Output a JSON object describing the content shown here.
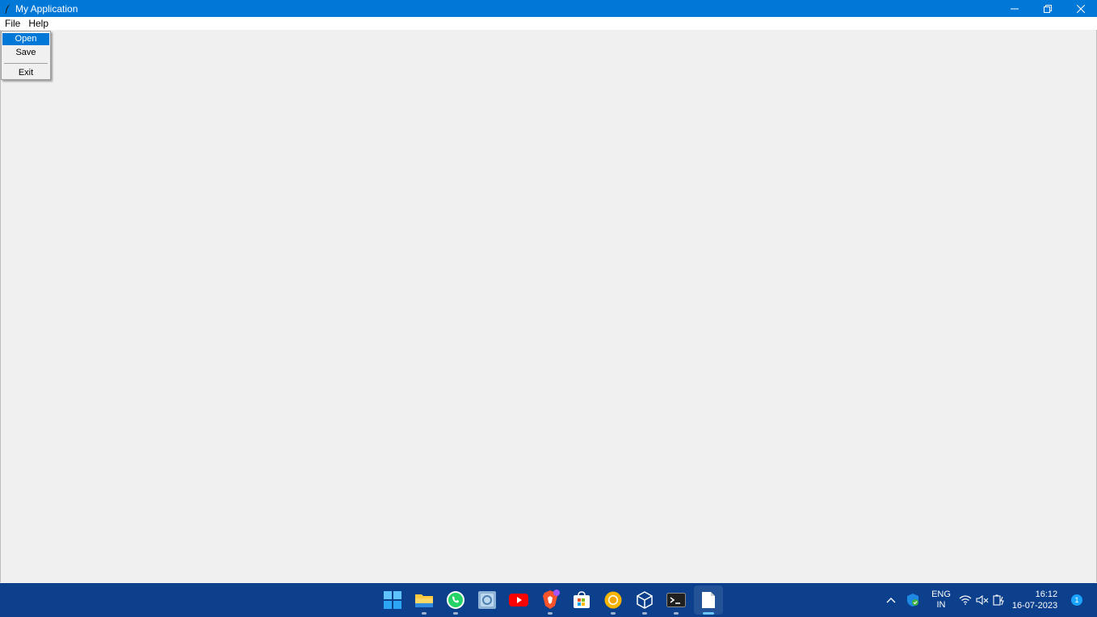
{
  "window": {
    "title": "My Application",
    "controls": {
      "minimize_icon": "minimize-icon",
      "restore_icon": "restore-icon",
      "close_icon": "close-icon"
    }
  },
  "menubar": {
    "file_label": "File",
    "help_label": "Help"
  },
  "file_menu": {
    "items": [
      "Open",
      "Save",
      "Exit"
    ],
    "selected": "Open"
  },
  "taskbar": {
    "apps": [
      "windows-start",
      "file-explorer",
      "whatsapp",
      "photos",
      "youtube",
      "brave",
      "microsoft-store",
      "chrome-canary",
      "virtualbox",
      "terminal",
      "notepad"
    ],
    "tray": {
      "lang_line1": "ENG",
      "lang_line2": "IN",
      "time": "16:12",
      "date": "16-07-2023",
      "notification_count": "1"
    }
  },
  "colors": {
    "titlebar": "#0078d7",
    "taskbar": "#0c3f8c",
    "selection": "#0078d7",
    "client_bg": "#f0f0f0"
  }
}
